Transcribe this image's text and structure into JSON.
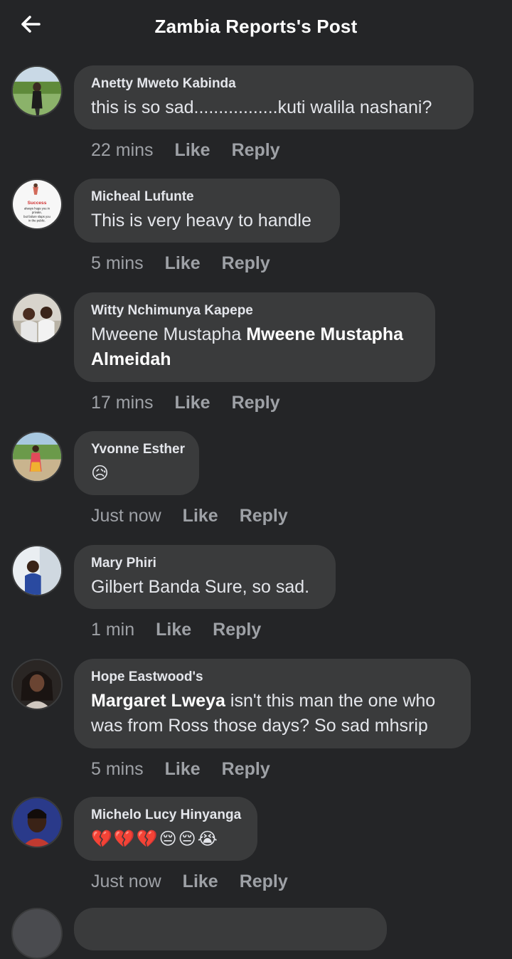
{
  "header": {
    "back_icon": "arrow-left-icon",
    "title": "Zambia Reports's Post"
  },
  "actions": {
    "like": "Like",
    "reply": "Reply"
  },
  "comments": [
    {
      "author": "Anetty Mweto Kabinda",
      "text": "this is so sad.................kuti walila nashani?",
      "time": "22 mins"
    },
    {
      "author": "Micheal Lufunte",
      "text": "This is very heavy to handle",
      "time": "5 mins",
      "avatar_text": {
        "l1": "Success",
        "l2": "always hugs you in",
        "l3": "private,",
        "l4": "but failure slaps you",
        "l5": "in the public."
      }
    },
    {
      "author": "Witty Nchimunya Kapepe",
      "text_plain": "Mweene Mustapha ",
      "text_bold_1": "Mweene Mustapha",
      "text_bold_2": "Almeidah",
      "time": "17 mins"
    },
    {
      "author": "Yvonne Esther",
      "text": "😥",
      "time": "Just now"
    },
    {
      "author": "Mary Phiri",
      "text": "Gilbert Banda Sure, so sad.",
      "time": "1 min"
    },
    {
      "author": "Hope Eastwood's",
      "text_bold": "Margaret Lweya",
      "text_line1": " isn't this man the one who",
      "text_line2": "was from Ross those days? So sad mhsrip",
      "time": "5 mins"
    },
    {
      "author": "Michelo Lucy Hinyanga",
      "text": "💔💔💔😔😔😭",
      "time": "Just now"
    }
  ],
  "colors": {
    "background": "#242527",
    "bubble": "#3a3b3c",
    "text": "#e4e6eb",
    "secondary": "#9ea1a6"
  }
}
